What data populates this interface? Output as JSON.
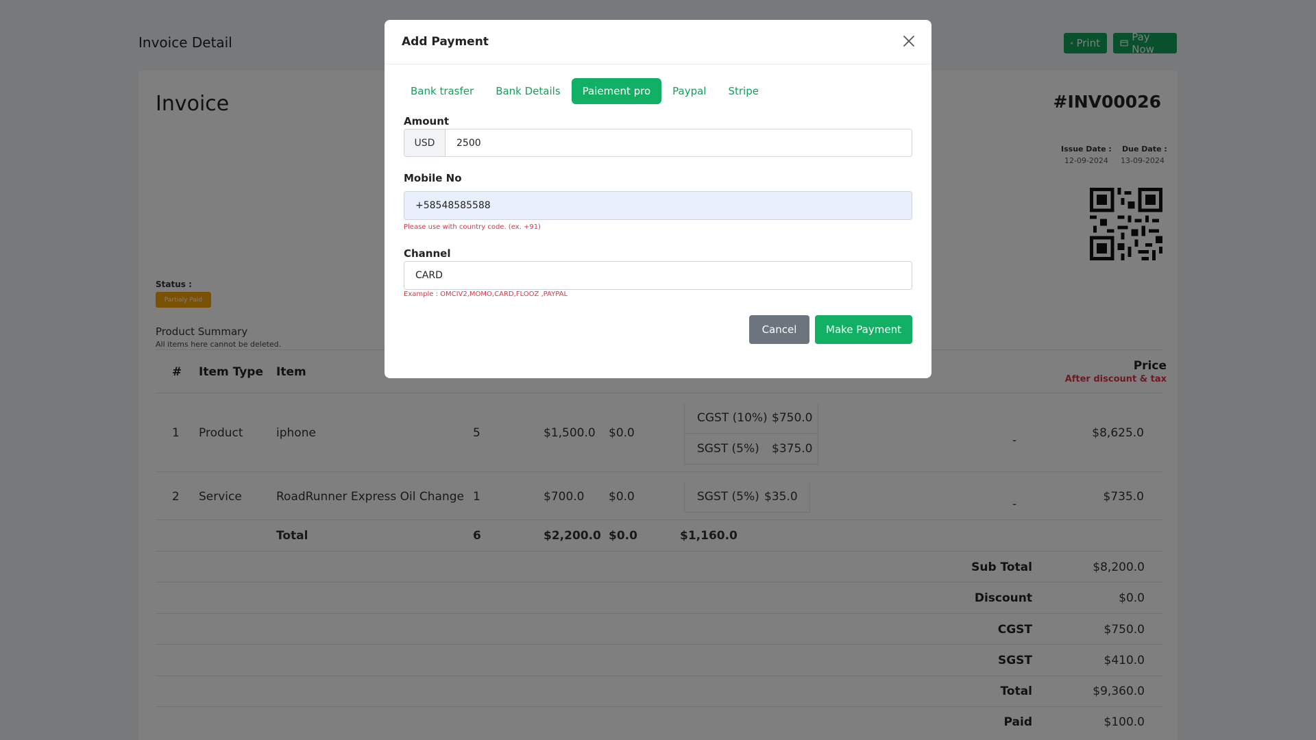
{
  "page": {
    "title": "Invoice Detail",
    "print_label": "Print",
    "pay_now_label": "Pay Now"
  },
  "invoice": {
    "title": "Invoice",
    "number": "#INV00026",
    "issue_date_label": "Issue Date :",
    "issue_date": "12-09-2024",
    "due_date_label": "Due Date :",
    "due_date": "13-09-2024",
    "status_label": "Status :",
    "status": "Partialy Paid",
    "product_summary_title": "Product Summary",
    "product_summary_sub": "All items here cannot be deleted."
  },
  "table": {
    "headers": {
      "num": "#",
      "item_type": "Item Type",
      "item": "Item",
      "price": "Price",
      "price_sub": "After discount & tax"
    },
    "rows": [
      {
        "num": "1",
        "type": "Product",
        "item": "iphone",
        "qty": "5",
        "amount": "$1,500.0",
        "discount": "$0.0",
        "taxes": [
          {
            "name": "CGST (10%)",
            "value": "$750.0"
          },
          {
            "name": "SGST (5%)",
            "value": "$375.0"
          }
        ],
        "extra": "-",
        "price": "$8,625.0"
      },
      {
        "num": "2",
        "type": "Service",
        "item": "RoadRunner Express Oil Change",
        "qty": "1",
        "amount": "$700.0",
        "discount": "$0.0",
        "taxes": [
          {
            "name": "SGST (5%)",
            "value": "$35.0"
          }
        ],
        "extra": "-",
        "price": "$735.0"
      }
    ],
    "total": {
      "label": "Total",
      "qty": "6",
      "amount": "$2,200.0",
      "discount": "$0.0",
      "tax": "$1,160.0"
    }
  },
  "summary": [
    {
      "label": "Sub Total",
      "value": "$8,200.0"
    },
    {
      "label": "Discount",
      "value": "$0.0"
    },
    {
      "label": "CGST",
      "value": "$750.0"
    },
    {
      "label": "SGST",
      "value": "$410.0"
    },
    {
      "label": "Total",
      "value": "$9,360.0"
    },
    {
      "label": "Paid",
      "value": "$100.0"
    }
  ],
  "modal": {
    "title": "Add Payment",
    "tabs": [
      "Bank trasfer",
      "Bank Details",
      "Paiement pro",
      "Paypal",
      "Stripe"
    ],
    "active_tab": "Paiement pro",
    "amount_label": "Amount",
    "currency": "USD",
    "amount_value": "2500",
    "mobile_label": "Mobile No",
    "mobile_value": "+58548585588",
    "mobile_hint": "Please use with country code. (ex. +91)",
    "channel_label": "Channel",
    "channel_value": "CARD",
    "channel_hint": "Example : OMCIV2,MOMO,CARD,FLOOZ ,PAYPAL",
    "cancel_label": "Cancel",
    "submit_label": "Make Payment"
  },
  "colors": {
    "accent": "#12b065",
    "danger": "#dc3545",
    "badge": "#f0a30a",
    "secondary": "#6c757d"
  }
}
